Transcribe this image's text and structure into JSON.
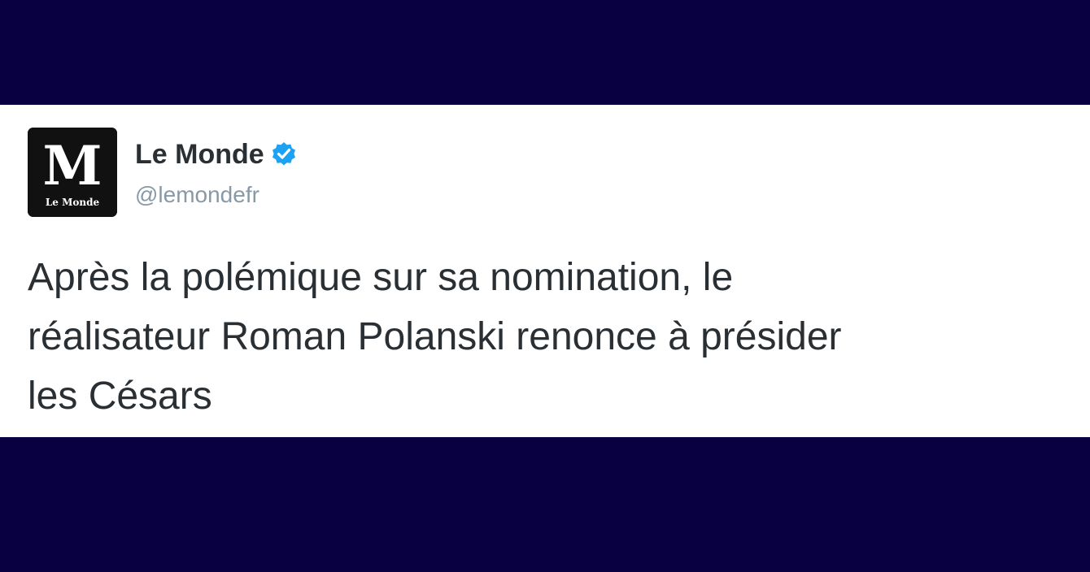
{
  "author": {
    "name": "Le Monde",
    "handle": "@lemondefr",
    "verified": true,
    "avatar_mark": "M",
    "avatar_caption": "Le Monde"
  },
  "tweet": {
    "text_lines": [
      "Après la polémique sur sa nomination, le",
      "réalisateur Roman Polanski renonce à présider",
      "les Césars"
    ]
  },
  "icons": {
    "verified": "verified-badge-icon",
    "avatar": "le-monde-logo"
  },
  "colors": {
    "background": "#080041",
    "card": "#ffffff",
    "name_text": "#292f33",
    "handle_text": "#8899a6",
    "verified_badge": "#1da1f2"
  }
}
